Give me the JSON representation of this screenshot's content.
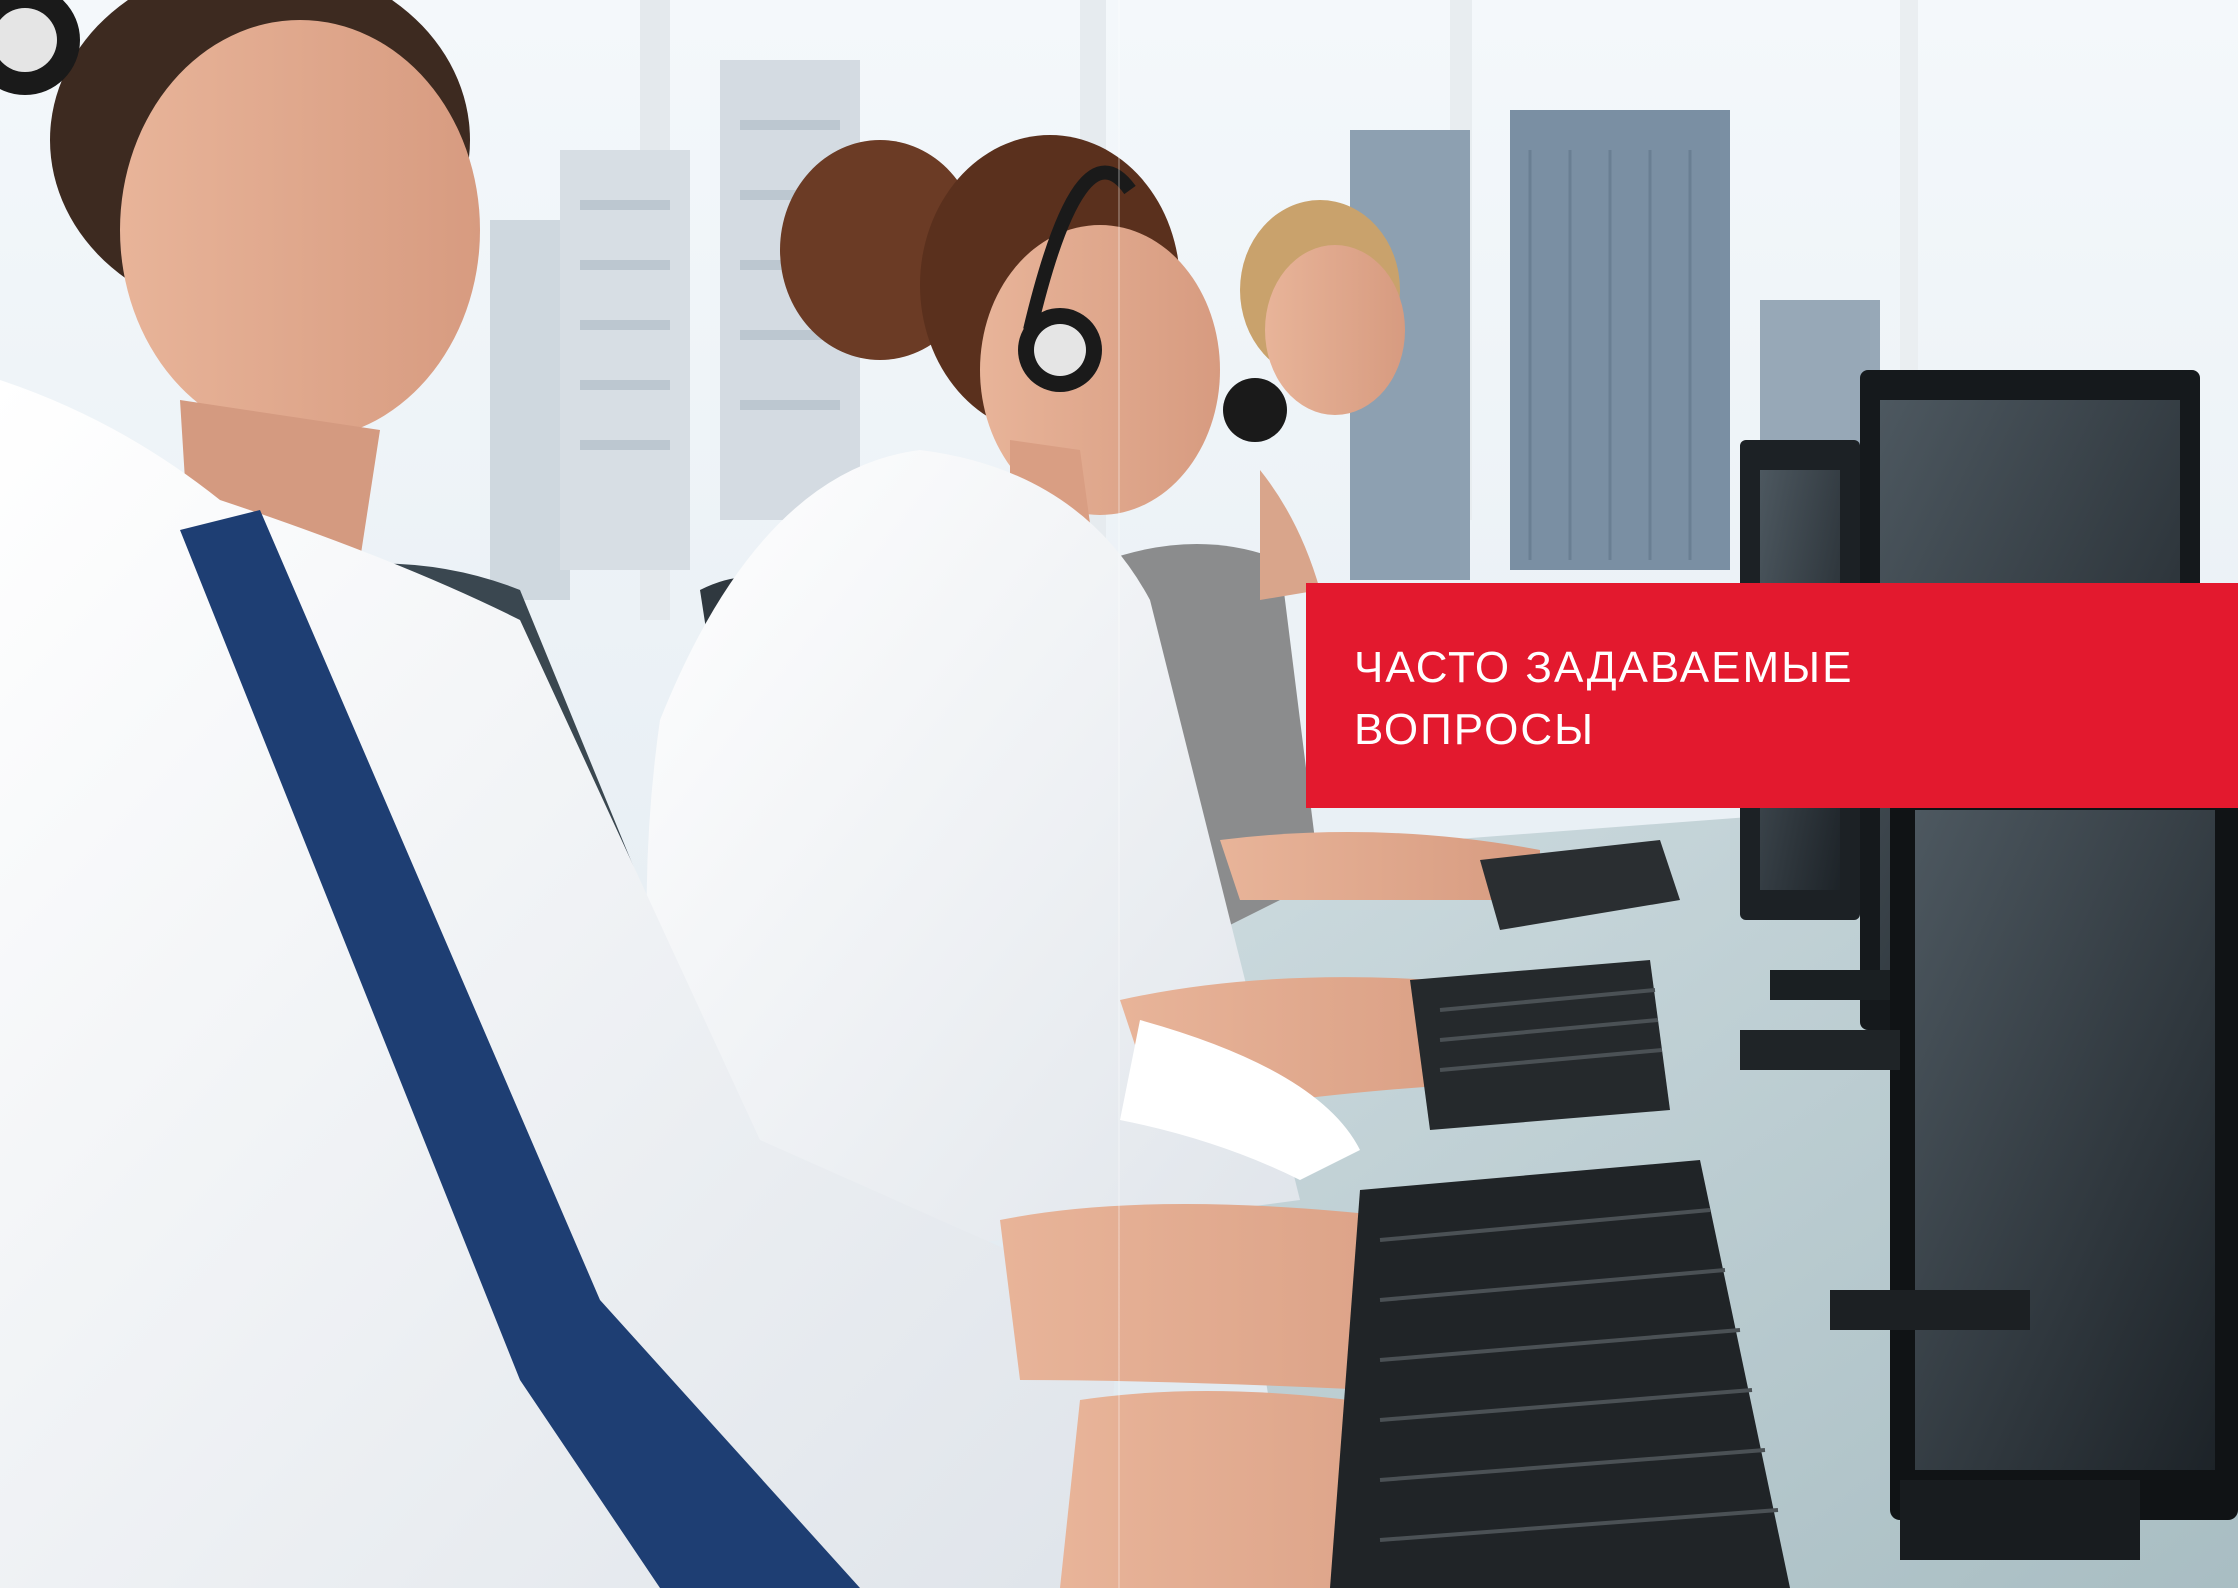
{
  "banner": {
    "title_line_1": "ЧАСТО ЗАДАВАЕМЫЕ",
    "title_line_2": "ВОПРОСЫ",
    "background_color": "#e3192e",
    "text_color": "#ffffff"
  },
  "photo": {
    "description_icon": "call-center-photo"
  }
}
